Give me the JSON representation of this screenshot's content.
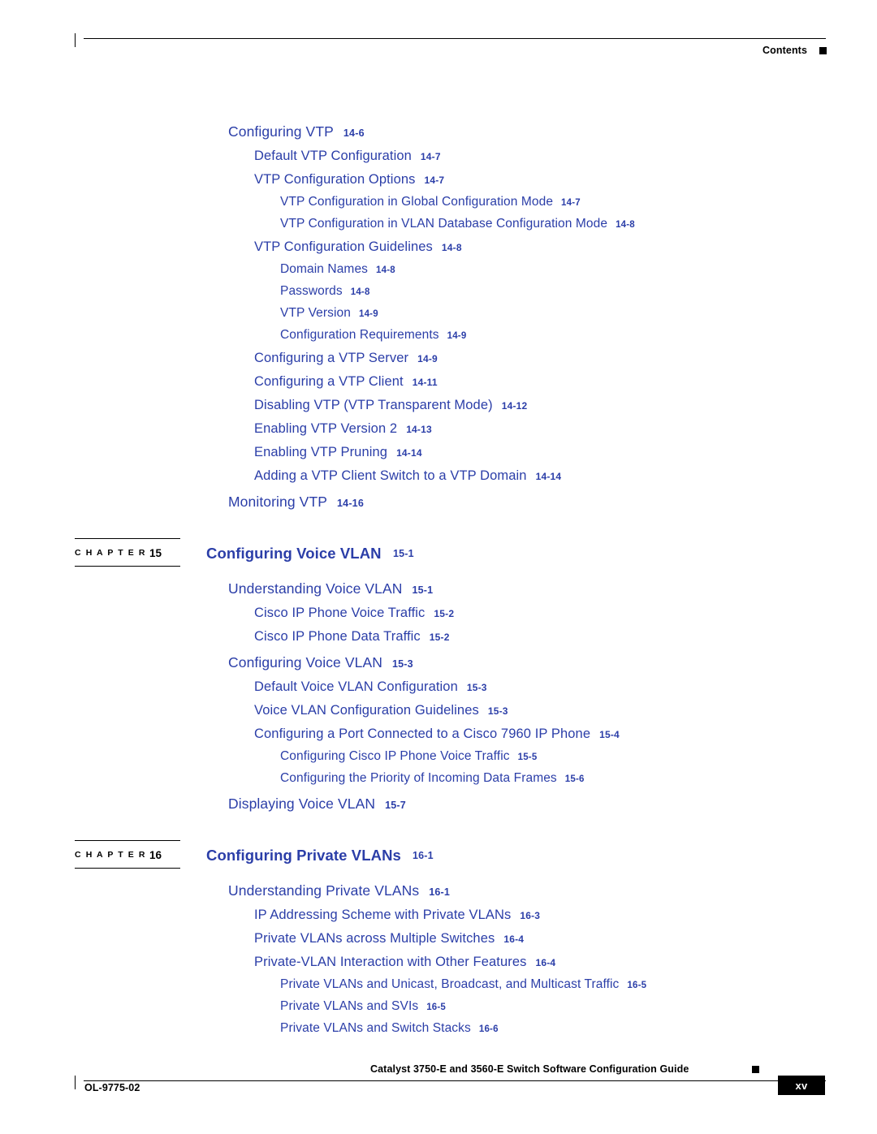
{
  "header": {
    "label": "Contents"
  },
  "footer": {
    "doc_title": "Catalyst 3750-E and 3560-E Switch Software Configuration Guide",
    "doc_id": "OL-9775-02",
    "page_number": "xv"
  },
  "toc": {
    "entries": [
      {
        "level": 1,
        "title": "Configuring VTP",
        "page": "14-6"
      },
      {
        "level": 2,
        "title": "Default VTP Configuration",
        "page": "14-7"
      },
      {
        "level": 2,
        "title": "VTP Configuration Options",
        "page": "14-7"
      },
      {
        "level": 3,
        "title": "VTP Configuration in Global Configuration Mode",
        "page": "14-7"
      },
      {
        "level": 3,
        "title": "VTP Configuration in VLAN Database Configuration Mode",
        "page": "14-8"
      },
      {
        "level": 2,
        "title": "VTP Configuration Guidelines",
        "page": "14-8"
      },
      {
        "level": 3,
        "title": "Domain Names",
        "page": "14-8"
      },
      {
        "level": 3,
        "title": "Passwords",
        "page": "14-8"
      },
      {
        "level": 3,
        "title": "VTP Version",
        "page": "14-9"
      },
      {
        "level": 3,
        "title": "Configuration Requirements",
        "page": "14-9"
      },
      {
        "level": 2,
        "title": "Configuring a VTP Server",
        "page": "14-9"
      },
      {
        "level": 2,
        "title": "Configuring a VTP Client",
        "page": "14-11"
      },
      {
        "level": 2,
        "title": "Disabling VTP (VTP Transparent Mode)",
        "page": "14-12"
      },
      {
        "level": 2,
        "title": "Enabling VTP Version 2",
        "page": "14-13"
      },
      {
        "level": 2,
        "title": "Enabling VTP Pruning",
        "page": "14-14"
      },
      {
        "level": 2,
        "title": "Adding a VTP Client Switch to a VTP Domain",
        "page": "14-14"
      },
      {
        "level": 1,
        "title": "Monitoring VTP",
        "page": "14-16"
      }
    ],
    "chapters": [
      {
        "label": "C H A P T E R",
        "number": "15",
        "title": "Configuring Voice VLAN",
        "page": "15-1",
        "entries": [
          {
            "level": 1,
            "title": "Understanding Voice VLAN",
            "page": "15-1"
          },
          {
            "level": 2,
            "title": "Cisco IP Phone Voice Traffic",
            "page": "15-2"
          },
          {
            "level": 2,
            "title": "Cisco IP Phone Data Traffic",
            "page": "15-2"
          },
          {
            "level": 1,
            "title": "Configuring Voice VLAN",
            "page": "15-3"
          },
          {
            "level": 2,
            "title": "Default Voice VLAN Configuration",
            "page": "15-3"
          },
          {
            "level": 2,
            "title": "Voice VLAN Configuration Guidelines",
            "page": "15-3"
          },
          {
            "level": 2,
            "title": "Configuring a Port Connected to a Cisco 7960 IP Phone",
            "page": "15-4"
          },
          {
            "level": 3,
            "title": "Configuring Cisco IP Phone Voice Traffic",
            "page": "15-5"
          },
          {
            "level": 3,
            "title": "Configuring the Priority of Incoming Data Frames",
            "page": "15-6"
          },
          {
            "level": 1,
            "title": "Displaying Voice VLAN",
            "page": "15-7"
          }
        ]
      },
      {
        "label": "C H A P T E R",
        "number": "16",
        "title": "Configuring Private VLANs",
        "page": "16-1",
        "entries": [
          {
            "level": 1,
            "title": "Understanding Private VLANs",
            "page": "16-1"
          },
          {
            "level": 2,
            "title": "IP Addressing Scheme with Private VLANs",
            "page": "16-3"
          },
          {
            "level": 2,
            "title": "Private VLANs across Multiple Switches",
            "page": "16-4"
          },
          {
            "level": 2,
            "title": "Private-VLAN Interaction with Other Features",
            "page": "16-4"
          },
          {
            "level": 3,
            "title": "Private VLANs and Unicast, Broadcast, and Multicast Traffic",
            "page": "16-5"
          },
          {
            "level": 3,
            "title": "Private VLANs and SVIs",
            "page": "16-5"
          },
          {
            "level": 3,
            "title": "Private VLANs and Switch Stacks",
            "page": "16-6"
          }
        ]
      }
    ]
  }
}
